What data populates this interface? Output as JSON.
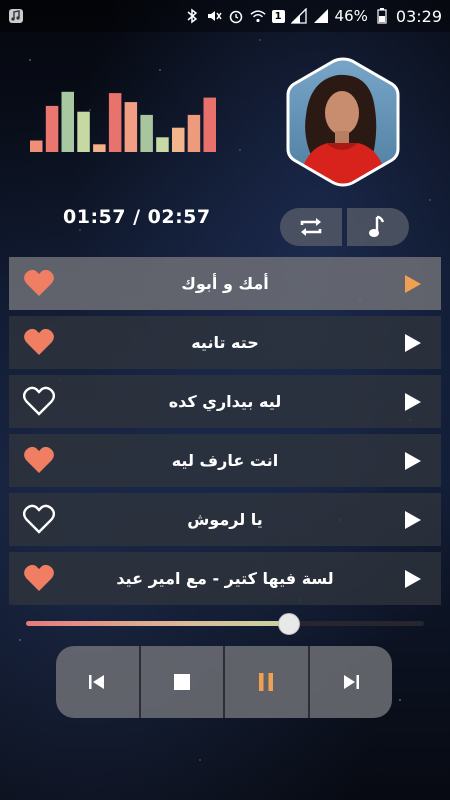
{
  "status_bar": {
    "battery": "46%",
    "time": "03:29",
    "sim_badge": "1"
  },
  "equalizer": {
    "levels": [
      0.18,
      0.72,
      0.94,
      0.63,
      0.12,
      0.92,
      0.78,
      0.58,
      0.23,
      0.38,
      0.58,
      0.85
    ],
    "colors": [
      "#ef8f77",
      "#e9776f",
      "#a7c8a0",
      "#c7d9a2",
      "#f3b089",
      "#e8726c",
      "#f19e85",
      "#a8c59d",
      "#c8d9a5",
      "#f3b58c",
      "#ee9a7c",
      "#e8726b"
    ]
  },
  "player": {
    "time_readout": "01:57 / 02:57",
    "progress": 0.66
  },
  "icons": {
    "repeat": "repeat-icon",
    "music": "music-note-icon",
    "heart": "heart-icon",
    "play": "play-icon"
  },
  "colors": {
    "accent": "#ef7e62",
    "active_play": "#f0a050"
  },
  "tracks": [
    {
      "title": "أمك و أبوك",
      "liked": true,
      "active": true
    },
    {
      "title": "حته تانيه",
      "liked": true,
      "active": false
    },
    {
      "title": "ليه بيداري كده",
      "liked": false,
      "active": false
    },
    {
      "title": "انت عارف ليه",
      "liked": true,
      "active": false
    },
    {
      "title": "يا لرموش",
      "liked": false,
      "active": false
    },
    {
      "title": "لسة فيها كتير - مع امير عيد",
      "liked": true,
      "active": false
    }
  ]
}
